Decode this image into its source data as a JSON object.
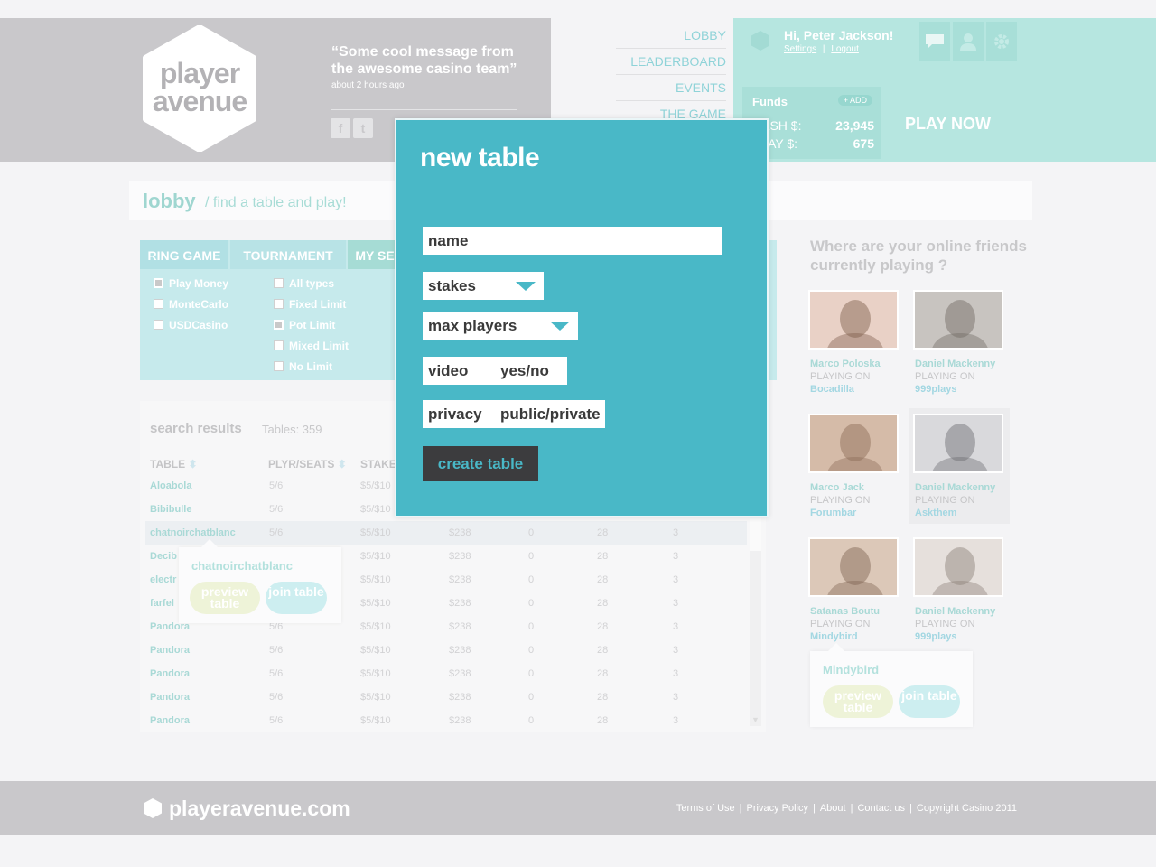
{
  "header": {
    "logo_line1": "player",
    "logo_line2": "avenue",
    "quote": "“Some cool message from the awesome casino team”",
    "quote_time": "about 2 hours ago",
    "social": [
      "f",
      "t"
    ]
  },
  "nav": [
    "LOBBY",
    "LEADERBOARD",
    "EVENTS",
    "THE GAME"
  ],
  "account": {
    "greeting": "Hi, Peter Jackson!",
    "settings": "Settings",
    "sep": "|",
    "logout": "Logout",
    "icons": [
      "chat-icon",
      "user-icon",
      "gear-icon"
    ],
    "funds_title": "Funds",
    "add_label": "+ ADD",
    "cash_label": "CASH $:",
    "cash_value": "23,945",
    "play_label": "PLAY $:",
    "play_value": "675",
    "play_now": "PLAY NOW"
  },
  "lobby": {
    "title": "lobby",
    "subtitle": "/ find a table and play!"
  },
  "filter": {
    "tabs": [
      "RING GAME",
      "TOURNAMENT",
      "MY SE"
    ],
    "col1": [
      {
        "label": "Play Money",
        "checked": true
      },
      {
        "label": "MonteCarlo",
        "checked": false
      },
      {
        "label": "USDCasino",
        "checked": false
      }
    ],
    "col2": [
      {
        "label": "All types",
        "checked": false
      },
      {
        "label": "Fixed Limit",
        "checked": false
      },
      {
        "label": "Pot Limit",
        "checked": true
      },
      {
        "label": "Mixed Limit",
        "checked": false
      },
      {
        "label": "No Limit",
        "checked": false
      }
    ]
  },
  "results": {
    "title": "search results",
    "count": "Tables: 359",
    "headers": [
      "TABLE",
      "PLYR/SEATS",
      "STAKE"
    ],
    "rows": [
      {
        "name": "Aloabola",
        "seats": "5/6",
        "stakes": "$5/$10",
        "pot": "",
        "c1": "",
        "c2": "",
        "c3": ""
      },
      {
        "name": "Bibibulle",
        "seats": "5/6",
        "stakes": "$5/$10",
        "pot": "",
        "c1": "",
        "c2": "",
        "c3": ""
      },
      {
        "name": "chatnoirchatblanc",
        "seats": "5/6",
        "stakes": "$5/$10",
        "pot": "$238",
        "c1": "0",
        "c2": "28",
        "c3": "3"
      },
      {
        "name": "Decib",
        "seats": "5/6",
        "stakes": "$5/$10",
        "pot": "$238",
        "c1": "0",
        "c2": "28",
        "c3": "3"
      },
      {
        "name": "electr",
        "seats": "5/6",
        "stakes": "$5/$10",
        "pot": "$238",
        "c1": "0",
        "c2": "28",
        "c3": "3"
      },
      {
        "name": "farfel",
        "seats": "5/6",
        "stakes": "$5/$10",
        "pot": "$238",
        "c1": "0",
        "c2": "28",
        "c3": "3"
      },
      {
        "name": "Pandora",
        "seats": "5/6",
        "stakes": "$5/$10",
        "pot": "$238",
        "c1": "0",
        "c2": "28",
        "c3": "3"
      },
      {
        "name": "Pandora",
        "seats": "5/6",
        "stakes": "$5/$10",
        "pot": "$238",
        "c1": "0",
        "c2": "28",
        "c3": "3"
      },
      {
        "name": "Pandora",
        "seats": "5/6",
        "stakes": "$5/$10",
        "pot": "$238",
        "c1": "0",
        "c2": "28",
        "c3": "3"
      },
      {
        "name": "Pandora",
        "seats": "5/6",
        "stakes": "$5/$10",
        "pot": "$238",
        "c1": "0",
        "c2": "28",
        "c3": "3"
      },
      {
        "name": "Pandora",
        "seats": "5/6",
        "stakes": "$5/$10",
        "pot": "$238",
        "c1": "0",
        "c2": "28",
        "c3": "3"
      }
    ],
    "popup": {
      "title": "chatnoirchatblanc",
      "preview": "preview table",
      "join": "join table"
    }
  },
  "friends": {
    "title": "Where are your online friends currently playing ?",
    "playing_on": "PLAYING ON",
    "list": [
      {
        "name": "Marco Poloska",
        "place": "Bocadilla"
      },
      {
        "name": "Daniel Mackenny",
        "place": "999plays"
      },
      {
        "name": "Marco Jack",
        "place": "Forumbar"
      },
      {
        "name": "Daniel Mackenny",
        "place": "Askthem"
      },
      {
        "name": "Satanas Boutu",
        "place": "Mindybird"
      },
      {
        "name": "Daniel Mackenny",
        "place": "999plays"
      }
    ],
    "popup": {
      "title": "Mindybird",
      "preview": "preview table",
      "join": "join table"
    }
  },
  "footer": {
    "logo": "playeravenue.com",
    "links": [
      "Terms of Use",
      "Privacy Policy",
      "About",
      "Contact us",
      "Copyright Casino 2011"
    ]
  },
  "modal": {
    "title": "new table",
    "name_placeholder": "name",
    "stakes": "stakes",
    "max_players": "max players",
    "video_label": "video",
    "video_value": "yes/no",
    "privacy_label": "privacy",
    "privacy_value": "public/private",
    "create": "create table"
  }
}
